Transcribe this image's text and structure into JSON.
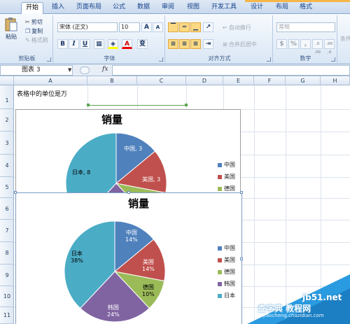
{
  "ribbon_tabs": [
    {
      "label": "开始",
      "active": true
    },
    {
      "label": "插入"
    },
    {
      "label": "页面布局"
    },
    {
      "label": "公式"
    },
    {
      "label": "数据"
    },
    {
      "label": "审阅"
    },
    {
      "label": "视图"
    },
    {
      "label": "开发工具"
    },
    {
      "label": "设计"
    },
    {
      "label": "布局"
    },
    {
      "label": "格式"
    }
  ],
  "clipboard": {
    "paste": "粘贴",
    "cut": "剪切",
    "copy": "复制",
    "format_painter": "格式刷",
    "group_label": "剪贴板"
  },
  "font": {
    "name": "宋体 (正文)",
    "size": "10",
    "grow": "A",
    "shrink": "A",
    "bold": "B",
    "italic": "I",
    "underline": "U",
    "font_color": "A",
    "wen": "变",
    "group_label": "字体"
  },
  "alignment": {
    "wrap_text": "自动换行",
    "merge_center": "合并后居中",
    "group_label": "对齐方式"
  },
  "number": {
    "format": "常规",
    "currency": "$",
    "percent": "%",
    "comma": ",",
    "inc_dec": ".0 .00",
    "dec_dec": ".00 .0",
    "group_label": "数字"
  },
  "styles": {
    "label": "条件"
  },
  "formula_bar": {
    "name_box": "图表 3",
    "fx": "fx",
    "value": ""
  },
  "columns": [
    "A",
    "B",
    "C",
    "D",
    "E",
    "F",
    "G",
    "H"
  ],
  "rows": [
    "1",
    "2",
    "3",
    "4",
    "5",
    "6",
    "7",
    "8",
    "9",
    "10",
    "11"
  ],
  "cells": {
    "a1": "表格中的单位是万"
  },
  "chart_top": {
    "title": "销量",
    "slices": [
      {
        "label": "中国, 3"
      },
      {
        "label": "美国, 3"
      },
      {
        "label": "日本, 8"
      }
    ],
    "legend": [
      "中国",
      "美国",
      "德国"
    ]
  },
  "chart_bottom": {
    "title": "销量",
    "slices": [
      {
        "name": "中国",
        "pct": "14%"
      },
      {
        "name": "美国",
        "pct": "14%"
      },
      {
        "name": "德国",
        "pct": "10%"
      },
      {
        "name": "韩国",
        "pct": "24%"
      },
      {
        "name": "日本",
        "pct": "38%"
      }
    ],
    "legend": [
      "中国",
      "美国",
      "德国",
      "韩国",
      "日本"
    ]
  },
  "chart_data": [
    {
      "type": "pie",
      "title": "销量",
      "categories": [
        "中国",
        "美国",
        "德国",
        "韩国",
        "日本"
      ],
      "values": [
        3,
        3,
        null,
        null,
        8
      ],
      "colors": [
        "#4f81bd",
        "#c0504d",
        "#9bbb59",
        "#8064a2",
        "#4bacc6"
      ],
      "legend_position": "right"
    },
    {
      "type": "pie",
      "title": "销量",
      "categories": [
        "中国",
        "美国",
        "德国",
        "韩国",
        "日本"
      ],
      "values": [
        14,
        14,
        10,
        24,
        38
      ],
      "value_format": "percent",
      "colors": [
        "#4f81bd",
        "#c0504d",
        "#9bbb59",
        "#8064a2",
        "#4bacc6"
      ],
      "legend_position": "right"
    }
  ],
  "watermark": {
    "line1": "查字典 教程网",
    "line2": "jb51.net",
    "line3": "jiaocheng.chazidian.com"
  },
  "colors": {
    "china": "#4f81bd",
    "usa": "#c0504d",
    "germany": "#9bbb59",
    "korea": "#8064a2",
    "japan": "#4bacc6"
  }
}
